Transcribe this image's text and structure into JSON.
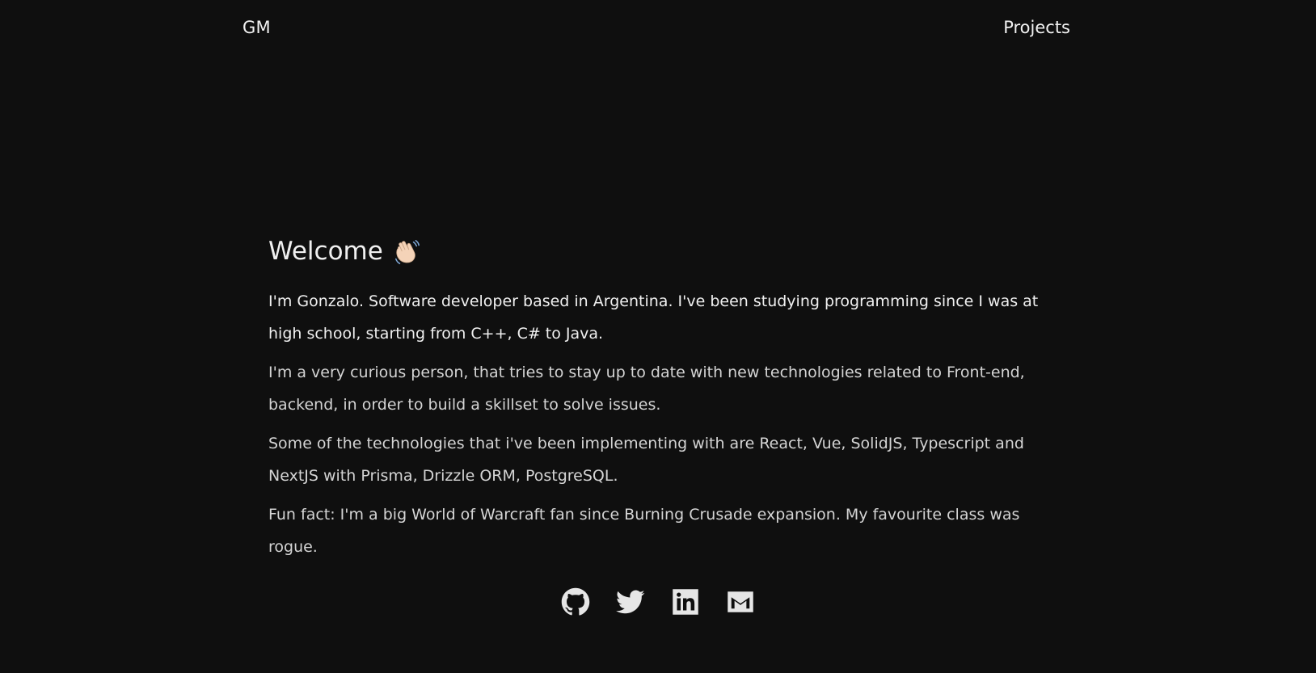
{
  "nav": {
    "logo": "GM",
    "projects_label": "Projects"
  },
  "main": {
    "title": "Welcome",
    "title_icon": "waving-hand-icon",
    "paragraphs": [
      "I'm Gonzalo. Software developer based in Argentina. I've been studying programming since I was at high school, starting from C++, C# to Java.",
      "I'm a very curious person, that tries to stay up to date with new technologies related to Front-end, backend, in order to build a skillset to solve issues.",
      "Some of the technologies that i've been implementing with are React, Vue, SolidJS, Typescript and NextJS with Prisma, Drizzle ORM, PostgreSQL.",
      "Fun fact: I'm a big World of Warcraft fan since Burning Crusade expansion. My favourite class was rogue."
    ]
  },
  "socials": [
    {
      "icon": "github-icon"
    },
    {
      "icon": "twitter-icon"
    },
    {
      "icon": "linkedin-icon"
    },
    {
      "icon": "mail-icon"
    }
  ],
  "colors": {
    "background": "#0f0f0f",
    "text": "#f0f0f0",
    "text_muted": "#d4d4d4",
    "icon": "#e6e6e6"
  }
}
